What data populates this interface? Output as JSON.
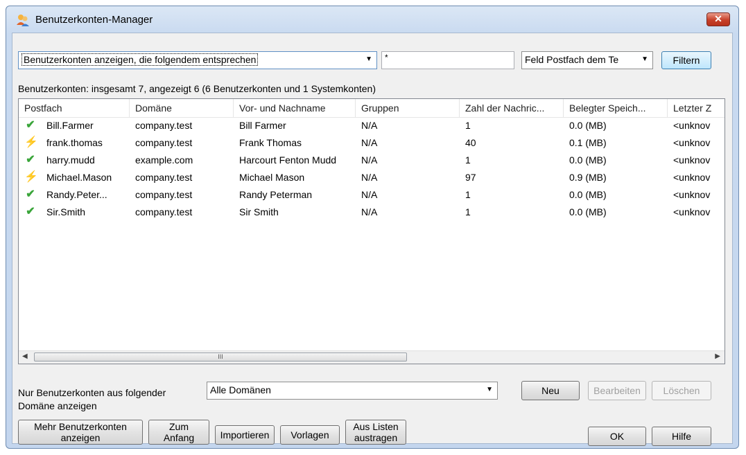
{
  "window": {
    "title": "Benutzerkonten-Manager",
    "close_label": "✕"
  },
  "filter": {
    "mode_value": "Benutzerkonten anzeigen, die folgendem entsprechen",
    "text_value": "*",
    "field_value": "Feld Postfach dem Te",
    "filter_button": "Filtern"
  },
  "summary": "Benutzerkonten: insgesamt 7, angezeigt 6 (6 Benutzerkonten und 1 Systemkonten)",
  "table": {
    "columns": [
      "Postfach",
      "Domäne",
      "Vor- und Nachname",
      "Gruppen",
      "Zahl der Nachric...",
      "Belegter Speich...",
      "Letzter Z"
    ],
    "rows": [
      {
        "status": "ok",
        "cells": [
          "Bill.Farmer",
          "company.test",
          "Bill Farmer",
          "N/A",
          "1",
          "0.0 (MB)",
          "<unknov"
        ]
      },
      {
        "status": "warn",
        "cells": [
          "frank.thomas",
          "company.test",
          "Frank Thomas",
          "N/A",
          "40",
          "0.1 (MB)",
          "<unknov"
        ]
      },
      {
        "status": "ok",
        "cells": [
          "harry.mudd",
          "example.com",
          "Harcourt Fenton Mudd",
          "N/A",
          "1",
          "0.0 (MB)",
          "<unknov"
        ]
      },
      {
        "status": "warn",
        "cells": [
          "Michael.Mason",
          "company.test",
          "Michael Mason",
          "N/A",
          "97",
          "0.9 (MB)",
          "<unknov"
        ]
      },
      {
        "status": "ok",
        "cells": [
          "Randy.Peter...",
          "company.test",
          "Randy Peterman",
          "N/A",
          "1",
          "0.0 (MB)",
          "<unknov"
        ]
      },
      {
        "status": "ok",
        "cells": [
          "Sir.Smith",
          "company.test",
          "Sir Smith",
          "N/A",
          "1",
          "0.0 (MB)",
          "<unknov"
        ]
      }
    ],
    "scroll_thumb_label": "III"
  },
  "domain": {
    "label": "Nur Benutzerkonten aus folgender Domäne anzeigen",
    "value": "Alle Domänen"
  },
  "buttons": {
    "neu": "Neu",
    "bearbeiten": "Bearbeiten",
    "loeschen": "Löschen",
    "mehr_line1": "Mehr Benutzerkonten",
    "mehr_line2": "anzeigen",
    "zum_line1": "Zum",
    "zum_line2": "Anfang",
    "importieren": "Importieren",
    "vorlagen": "Vorlagen",
    "aus_line1": "Aus Listen",
    "aus_line2": "austragen",
    "ok": "OK",
    "hilfe": "Hilfe"
  },
  "colors": {
    "ok_icon": "#3aa53a",
    "warn_icon": "#f0a010",
    "close_button": "#c7402a"
  },
  "icons": {
    "title": "users-icon",
    "ok": "checkmark-icon",
    "warn": "lightning-icon"
  }
}
